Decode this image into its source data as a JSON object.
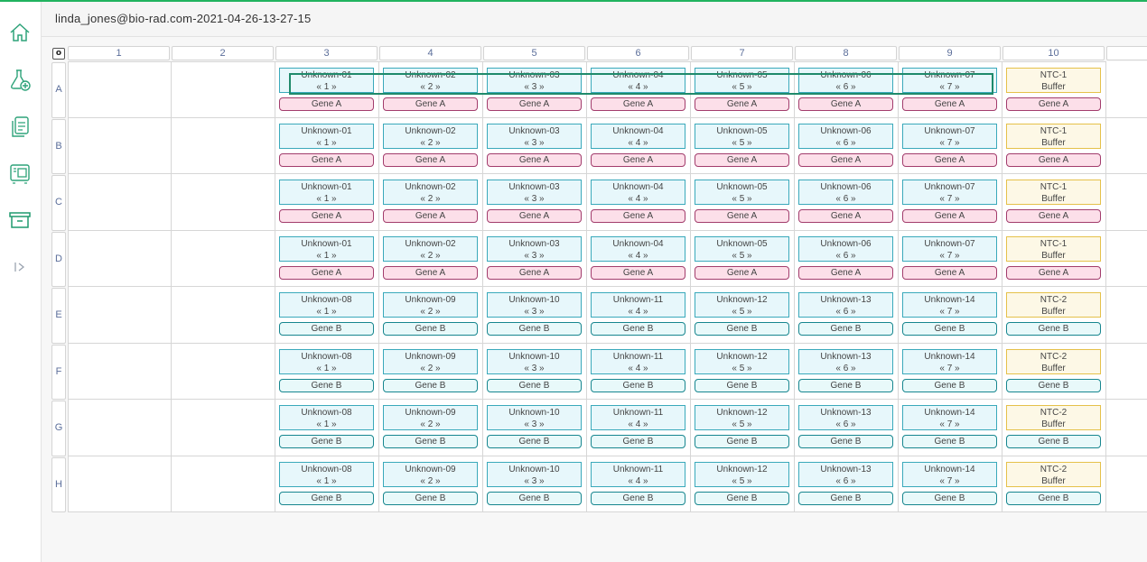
{
  "header": {
    "title": "linda_jones@bio-rad.com-2021-04-26-13-27-15"
  },
  "sidebar": {
    "icons": [
      "home-icon",
      "add-experiment-icon",
      "documents-icon",
      "instrument-icon",
      "archive-icon",
      "expand-icon"
    ]
  },
  "colors": {
    "accent": "#21b35f",
    "sample_border": "#3aa9bb",
    "ntc_border": "#e5c14a",
    "gene_a": "#a23c6c",
    "gene_b": "#17868f"
  },
  "plate": {
    "corner_label": "o",
    "columns": [
      "1",
      "2",
      "3",
      "4",
      "5",
      "6",
      "7",
      "8",
      "9",
      "10"
    ],
    "rows": [
      "A",
      "B",
      "C",
      "D",
      "E",
      "F",
      "G",
      "H"
    ],
    "row_samples": {
      "A": [
        "Unknown-01",
        "Unknown-02",
        "Unknown-03",
        "Unknown-04",
        "Unknown-05",
        "Unknown-06",
        "Unknown-07",
        "NTC-1"
      ],
      "B": [
        "Unknown-01",
        "Unknown-02",
        "Unknown-03",
        "Unknown-04",
        "Unknown-05",
        "Unknown-06",
        "Unknown-07",
        "NTC-1"
      ],
      "C": [
        "Unknown-01",
        "Unknown-02",
        "Unknown-03",
        "Unknown-04",
        "Unknown-05",
        "Unknown-06",
        "Unknown-07",
        "NTC-1"
      ],
      "D": [
        "Unknown-01",
        "Unknown-02",
        "Unknown-03",
        "Unknown-04",
        "Unknown-05",
        "Unknown-06",
        "Unknown-07",
        "NTC-1"
      ],
      "E": [
        "Unknown-08",
        "Unknown-09",
        "Unknown-10",
        "Unknown-11",
        "Unknown-12",
        "Unknown-13",
        "Unknown-14",
        "NTC-2"
      ],
      "F": [
        "Unknown-08",
        "Unknown-09",
        "Unknown-10",
        "Unknown-11",
        "Unknown-12",
        "Unknown-13",
        "Unknown-14",
        "NTC-2"
      ],
      "G": [
        "Unknown-08",
        "Unknown-09",
        "Unknown-10",
        "Unknown-11",
        "Unknown-12",
        "Unknown-13",
        "Unknown-14",
        "NTC-2"
      ],
      "H": [
        "Unknown-08",
        "Unknown-09",
        "Unknown-10",
        "Unknown-11",
        "Unknown-12",
        "Unknown-13",
        "Unknown-14",
        "NTC-2"
      ]
    },
    "replicates": [
      "« 1 »",
      "« 2 »",
      "« 3 »",
      "« 4 »",
      "« 5 »",
      "« 6 »",
      "« 7 »",
      "Buffer"
    ],
    "row_targets": {
      "A": "Gene A",
      "B": "Gene A",
      "C": "Gene A",
      "D": "Gene A",
      "E": "Gene B",
      "F": "Gene B",
      "G": "Gene B",
      "H": "Gene B"
    }
  }
}
